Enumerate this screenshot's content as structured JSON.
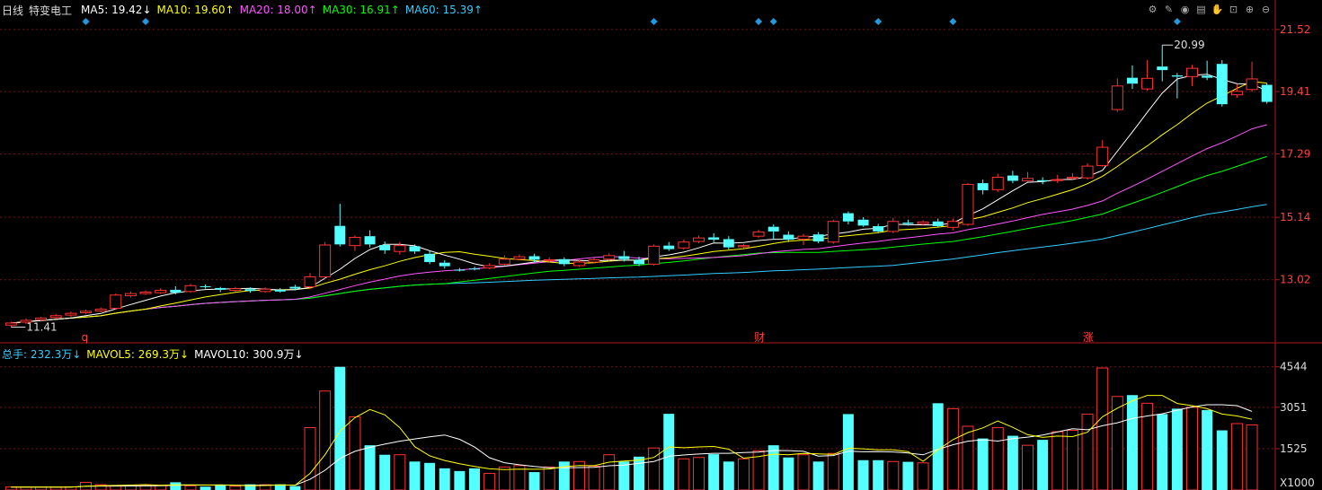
{
  "header": {
    "period": "日线",
    "stock_name": "特变电工",
    "ma": [
      {
        "label": "MA5: 19.42↓",
        "color": "#ffffff"
      },
      {
        "label": "MA10: 19.60↑",
        "color": "#ffff00"
      },
      {
        "label": "MA20: 18.00↑",
        "color": "#ff55ff"
      },
      {
        "label": "MA30: 16.91↑",
        "color": "#00ff00"
      },
      {
        "label": "MA60: 15.39↑",
        "color": "#33ccff"
      }
    ]
  },
  "volume_header": [
    {
      "label": "总手: 232.3万↓",
      "color": "#33ccff"
    },
    {
      "label": "MAVOL5: 269.3万↓",
      "color": "#ffff00"
    },
    {
      "label": "MAVOL10: 300.9万↓",
      "color": "#ffffff"
    }
  ],
  "toolbar": {
    "icons": [
      "gear-icon",
      "pen-icon",
      "eye-icon",
      "store-icon",
      "hand-icon",
      "lock-icon",
      "zoom-in-icon",
      "zoom-out-icon"
    ]
  },
  "chart_data": {
    "type": "candlestick",
    "price_axis": {
      "ticks": [
        "21.52",
        "19.41",
        "17.29",
        "15.14",
        "13.02"
      ],
      "range": [
        11.0,
        21.85
      ]
    },
    "volume_axis": {
      "ticks": [
        "4544",
        "3051",
        "1525"
      ],
      "unit_label": "X1000",
      "range": [
        0,
        4700
      ]
    },
    "annotations": {
      "high": "20.99",
      "low": "11.41"
    },
    "markers": [
      {
        "index": 5,
        "label": "q"
      },
      {
        "index": 50,
        "label": "财"
      },
      {
        "index": 72,
        "label": "涨"
      }
    ],
    "event_diamond_indices": [
      5,
      9,
      43,
      50,
      51,
      58,
      63,
      78
    ],
    "candles": [
      [
        11.48,
        11.55,
        11.6,
        11.41
      ],
      [
        11.58,
        11.64,
        11.7,
        11.52
      ],
      [
        11.66,
        11.72,
        11.76,
        11.6
      ],
      [
        11.74,
        11.8,
        11.86,
        11.68
      ],
      [
        11.82,
        11.88,
        11.94,
        11.76
      ],
      [
        11.9,
        11.95,
        12.0,
        11.86
      ],
      [
        11.96,
        12.02,
        12.08,
        11.92
      ],
      [
        12.05,
        12.5,
        12.55,
        12.0
      ],
      [
        12.48,
        12.55,
        12.62,
        12.42
      ],
      [
        12.55,
        12.6,
        12.66,
        12.5
      ],
      [
        12.58,
        12.66,
        12.72,
        12.54
      ],
      [
        12.68,
        12.58,
        12.8,
        12.52
      ],
      [
        12.62,
        12.82,
        12.88,
        12.58
      ],
      [
        12.8,
        12.78,
        12.86,
        12.72
      ],
      [
        12.74,
        12.68,
        12.78,
        12.6
      ],
      [
        12.66,
        12.72,
        12.78,
        12.62
      ],
      [
        12.7,
        12.64,
        12.76,
        12.58
      ],
      [
        12.62,
        12.7,
        12.76,
        12.58
      ],
      [
        12.68,
        12.62,
        12.74,
        12.58
      ],
      [
        12.78,
        12.72,
        12.85,
        12.66
      ],
      [
        12.78,
        13.12,
        13.25,
        12.7
      ],
      [
        13.12,
        14.2,
        14.3,
        13.05
      ],
      [
        14.85,
        14.22,
        15.6,
        14.15
      ],
      [
        14.18,
        14.46,
        14.52,
        14.0
      ],
      [
        14.5,
        14.22,
        14.7,
        14.12
      ],
      [
        14.2,
        14.02,
        14.32,
        13.9
      ],
      [
        13.98,
        14.18,
        14.3,
        13.88
      ],
      [
        14.16,
        13.98,
        14.22,
        13.9
      ],
      [
        13.9,
        13.62,
        14.0,
        13.55
      ],
      [
        13.6,
        13.48,
        13.68,
        13.4
      ],
      [
        13.36,
        13.34,
        13.42,
        13.3
      ],
      [
        13.4,
        13.38,
        13.46,
        13.34
      ],
      [
        13.42,
        13.5,
        13.58,
        13.38
      ],
      [
        13.55,
        13.72,
        13.85,
        13.5
      ],
      [
        13.72,
        13.8,
        13.88,
        13.68
      ],
      [
        13.82,
        13.7,
        13.9,
        13.62
      ],
      [
        13.68,
        13.7,
        13.78,
        13.62
      ],
      [
        13.72,
        13.55,
        13.78,
        13.48
      ],
      [
        13.5,
        13.62,
        13.7,
        13.46
      ],
      [
        13.62,
        13.7,
        13.76,
        13.58
      ],
      [
        13.72,
        13.84,
        13.92,
        13.66
      ],
      [
        13.82,
        13.72,
        14.0,
        13.64
      ],
      [
        13.7,
        13.55,
        13.8,
        13.48
      ],
      [
        13.55,
        14.16,
        14.22,
        13.5
      ],
      [
        14.18,
        14.06,
        14.3,
        14.0
      ],
      [
        14.1,
        14.3,
        14.38,
        14.04
      ],
      [
        14.32,
        14.44,
        14.52,
        14.26
      ],
      [
        14.46,
        14.38,
        14.6,
        14.3
      ],
      [
        14.4,
        14.12,
        14.5,
        14.05
      ],
      [
        14.14,
        14.18,
        14.24,
        14.08
      ],
      [
        14.5,
        14.64,
        14.72,
        14.44
      ],
      [
        14.82,
        14.66,
        14.9,
        14.4
      ],
      [
        14.55,
        14.38,
        14.66,
        14.3
      ],
      [
        14.4,
        14.5,
        14.58,
        14.2
      ],
      [
        14.56,
        14.32,
        14.64,
        14.26
      ],
      [
        14.3,
        15.0,
        15.06,
        14.24
      ],
      [
        15.28,
        15.0,
        15.34,
        14.9
      ],
      [
        15.06,
        14.86,
        15.14,
        14.82
      ],
      [
        14.84,
        14.66,
        14.92,
        14.6
      ],
      [
        14.66,
        15.0,
        15.12,
        14.6
      ],
      [
        14.96,
        14.92,
        15.06,
        14.86
      ],
      [
        14.92,
        14.98,
        15.04,
        14.86
      ],
      [
        15.0,
        14.84,
        15.1,
        14.8
      ],
      [
        14.8,
        15.0,
        15.1,
        14.7
      ],
      [
        14.9,
        16.26,
        16.3,
        14.85
      ],
      [
        16.3,
        16.06,
        16.42,
        15.92
      ],
      [
        16.08,
        16.5,
        16.62,
        16.0
      ],
      [
        16.56,
        16.38,
        16.72,
        16.3
      ],
      [
        16.38,
        16.46,
        16.68,
        16.34
      ],
      [
        16.4,
        16.36,
        16.5,
        16.26
      ],
      [
        16.4,
        16.42,
        16.58,
        16.3
      ],
      [
        16.46,
        16.5,
        16.64,
        16.4
      ],
      [
        16.48,
        16.88,
        16.98,
        16.42
      ],
      [
        16.9,
        17.52,
        17.76,
        16.86
      ],
      [
        18.8,
        19.6,
        19.86,
        18.72
      ],
      [
        19.88,
        19.68,
        20.3,
        19.5
      ],
      [
        19.5,
        19.86,
        20.48,
        19.44
      ],
      [
        20.26,
        20.14,
        20.99,
        19.76
      ],
      [
        19.96,
        19.92,
        20.04,
        19.18
      ],
      [
        19.92,
        20.2,
        20.32,
        19.6
      ],
      [
        19.95,
        19.88,
        20.46,
        19.8
      ],
      [
        20.35,
        18.98,
        20.48,
        18.9
      ],
      [
        19.3,
        19.42,
        19.66,
        19.2
      ],
      [
        19.48,
        19.84,
        20.42,
        19.4
      ],
      [
        19.64,
        19.06,
        19.7,
        19.0
      ]
    ],
    "volumes": [
      110,
      105,
      103,
      100,
      115,
      280,
      195,
      160,
      165,
      185,
      170,
      285,
      155,
      125,
      165,
      140,
      210,
      195,
      210,
      145,
      2300,
      3650,
      4544,
      2700,
      1650,
      1300,
      1300,
      1050,
      1000,
      800,
      700,
      800,
      610,
      850,
      900,
      660,
      850,
      1050,
      1050,
      880,
      1300,
      1050,
      1230,
      1550,
      2810,
      1150,
      1200,
      1320,
      1050,
      1150,
      1450,
      1650,
      1200,
      1300,
      1050,
      1350,
      2800,
      1100,
      1100,
      1050,
      1040,
      1000,
      3200,
      3000,
      2350,
      1900,
      2300,
      2000,
      1650,
      1850,
      2150,
      2200,
      2800,
      4500,
      3450,
      3500,
      3200,
      2800,
      3000,
      3050,
      2950,
      2200,
      2450,
      2400
    ]
  }
}
